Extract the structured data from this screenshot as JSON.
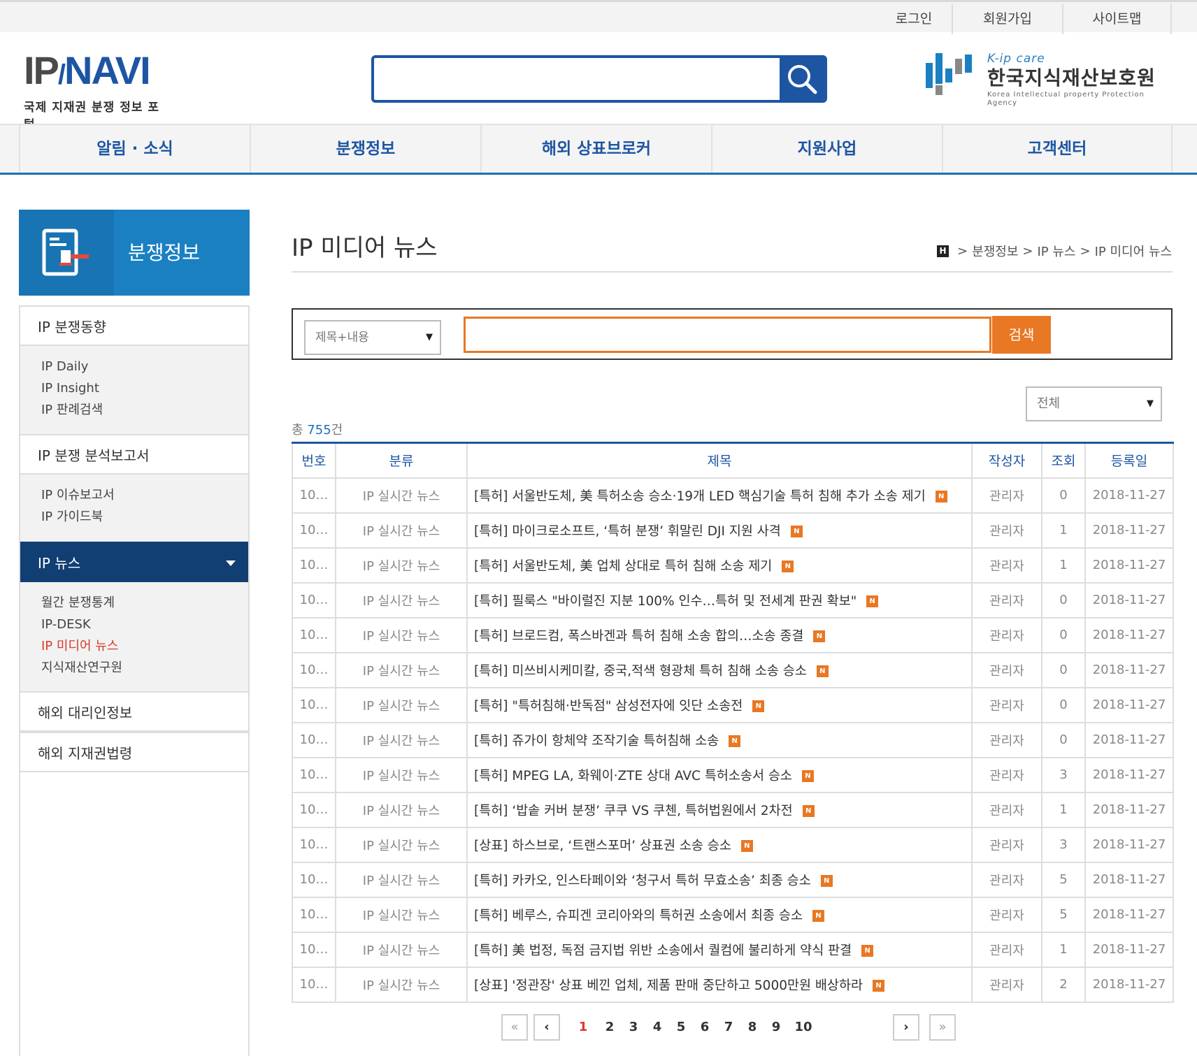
{
  "utility": {
    "login": "로그인",
    "signup": "회원가입",
    "sitemap": "사이트맵"
  },
  "logo": {
    "main_a": "IP",
    "main_b": "NAVI",
    "sub": "국제 지재권 분쟁 정보 포털"
  },
  "search": {
    "value": ""
  },
  "agency": {
    "brand": "K-ip care",
    "name": "한국지식재산보호원",
    "english": "Korea Intellectual property Protection Agency"
  },
  "gnb": [
    "알림 · 소식",
    "분쟁정보",
    "해외 상표브로커",
    "지원사업",
    "고객센터"
  ],
  "sidebar": {
    "header": "분쟁정보",
    "sections": [
      {
        "label": "IP 분쟁동향",
        "sub": [
          "IP Daily",
          "IP Insight",
          "IP 판례검색"
        ]
      },
      {
        "label": "IP 분쟁 분석보고서",
        "sub": [
          "IP 이슈보고서",
          "IP 가이드북"
        ]
      },
      {
        "label": "IP 뉴스",
        "sub": [
          "월간 분쟁통계",
          "IP-DESK",
          "IP 미디어 뉴스",
          "지식재산연구원"
        ]
      },
      {
        "label": "해외 대리인정보"
      },
      {
        "label": "해외 지재권법령"
      }
    ]
  },
  "page": {
    "title": "IP 미디어 뉴스"
  },
  "breadcrumb": {
    "home": "H",
    "items": [
      "분쟁정보",
      "IP 뉴스",
      "IP 미디어 뉴스"
    ]
  },
  "filter": {
    "field_select": "제목+내용",
    "keyword": "",
    "button": "검색",
    "category_select": "전체"
  },
  "total": {
    "prefix": "총 ",
    "count": "755",
    "suffix": "건"
  },
  "table": {
    "headers": [
      "번호",
      "분류",
      "제목",
      "작성자",
      "조회",
      "등록일"
    ],
    "new_badge": "N",
    "rows": [
      {
        "no": "10…",
        "cat": "IP 실시간 뉴스",
        "title": "[특허] 서울반도체, 美 특허소송 승소·19개 LED 핵심기술 특허 침해 추가 소송 제기",
        "author": "관리자",
        "views": "0",
        "date": "2018-11-27"
      },
      {
        "no": "10…",
        "cat": "IP 실시간 뉴스",
        "title": "[특허] 마이크로소프트, ‘특허 분쟁’ 휘말린 DJI 지원 사격",
        "author": "관리자",
        "views": "1",
        "date": "2018-11-27"
      },
      {
        "no": "10…",
        "cat": "IP 실시간 뉴스",
        "title": "[특허] 서울반도체, 美 업체 상대로 특허 침해 소송 제기",
        "author": "관리자",
        "views": "1",
        "date": "2018-11-27"
      },
      {
        "no": "10…",
        "cat": "IP 실시간 뉴스",
        "title": "[특허] 필룩스 \"바이럴진 지분 100% 인수…특허 및 전세계 판권 확보\"",
        "author": "관리자",
        "views": "0",
        "date": "2018-11-27"
      },
      {
        "no": "10…",
        "cat": "IP 실시간 뉴스",
        "title": "[특허] 브로드컴, 폭스바겐과 특허 침해 소송 합의…소송 종결",
        "author": "관리자",
        "views": "0",
        "date": "2018-11-27"
      },
      {
        "no": "10…",
        "cat": "IP 실시간 뉴스",
        "title": "[특허] 미쓰비시케미칼, 중국,적색 형광체 특허 침해 소송 승소",
        "author": "관리자",
        "views": "0",
        "date": "2018-11-27"
      },
      {
        "no": "10…",
        "cat": "IP 실시간 뉴스",
        "title": "[특허] \"특허침해·반독점\" 삼성전자에 잇단 소송전",
        "author": "관리자",
        "views": "0",
        "date": "2018-11-27"
      },
      {
        "no": "10…",
        "cat": "IP 실시간 뉴스",
        "title": "[특허] 쥬가이 항체약 조작기술 특허침해 소송",
        "author": "관리자",
        "views": "0",
        "date": "2018-11-27"
      },
      {
        "no": "10…",
        "cat": "IP 실시간 뉴스",
        "title": "[특허] MPEG LA, 화웨이·ZTE 상대 AVC 특허소송서 승소",
        "author": "관리자",
        "views": "3",
        "date": "2018-11-27"
      },
      {
        "no": "10…",
        "cat": "IP 실시간 뉴스",
        "title": "[특허] ‘밥솥 커버 분쟁’ 쿠쿠 VS 쿠첸, 특허법원에서 2차전",
        "author": "관리자",
        "views": "1",
        "date": "2018-11-27"
      },
      {
        "no": "10…",
        "cat": "IP 실시간 뉴스",
        "title": "[상표] 하스브로, ‘트랜스포머’ 상표권 소송 승소",
        "author": "관리자",
        "views": "3",
        "date": "2018-11-27"
      },
      {
        "no": "10…",
        "cat": "IP 실시간 뉴스",
        "title": "[특허] 카카오, 인스타페이와 ‘청구서 특허 무효소송’ 최종 승소",
        "author": "관리자",
        "views": "5",
        "date": "2018-11-27"
      },
      {
        "no": "10…",
        "cat": "IP 실시간 뉴스",
        "title": "[특허] 베루스, 슈피겐 코리아와의 특허권 소송에서 최종 승소",
        "author": "관리자",
        "views": "5",
        "date": "2018-11-27"
      },
      {
        "no": "10…",
        "cat": "IP 실시간 뉴스",
        "title": "[특허] 美 법정, 독점 금지법 위반 소송에서 퀄컴에 불리하게 약식 판결",
        "author": "관리자",
        "views": "1",
        "date": "2018-11-27"
      },
      {
        "no": "10…",
        "cat": "IP 실시간 뉴스",
        "title": "[상표] '정관장' 상표 베낀 업체, 제품 판매 중단하고 5000만원 배상하라",
        "author": "관리자",
        "views": "2",
        "date": "2018-11-27"
      }
    ]
  },
  "pagination": {
    "first": "«",
    "prev": "‹",
    "next": "›",
    "last": "»",
    "pages": [
      "1",
      "2",
      "3",
      "4",
      "5",
      "6",
      "7",
      "8",
      "9",
      "10"
    ],
    "current": "1"
  }
}
